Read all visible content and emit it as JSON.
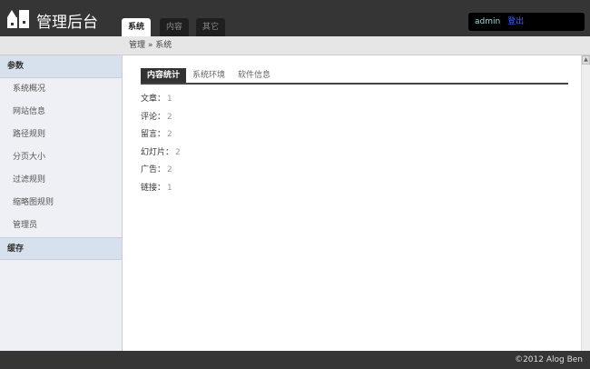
{
  "header": {
    "title": "管理后台",
    "tabs": [
      "系统",
      "内容",
      "其它"
    ],
    "user": "admin",
    "logout": "登出"
  },
  "breadcrumb": "管理 » 系统",
  "sidebar": {
    "sections": [
      {
        "label": "参数",
        "items": [
          "系统概况",
          "网站信息",
          "路径规则",
          "分页大小",
          "过滤规则",
          "缩略图规则",
          "管理员"
        ]
      },
      {
        "label": "缓存",
        "items": []
      }
    ]
  },
  "main": {
    "tabs": [
      "内容统计",
      "系统环境",
      "软件信息"
    ],
    "stats": [
      {
        "label": "文章：",
        "value": "1"
      },
      {
        "label": "评论：",
        "value": "2"
      },
      {
        "label": "留言：",
        "value": "2"
      },
      {
        "label": "幻灯片：",
        "value": "2"
      },
      {
        "label": "广告：",
        "value": "2"
      },
      {
        "label": "链接：",
        "value": "1"
      }
    ]
  },
  "footer": "©2012 Alog Ben"
}
